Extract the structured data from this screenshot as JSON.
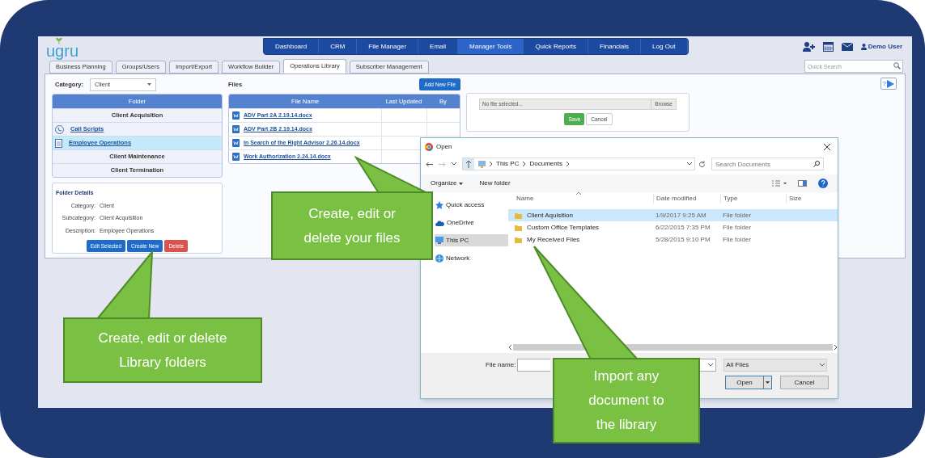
{
  "logo": "ugru",
  "nav": [
    {
      "label": "Dashboard",
      "selected": false
    },
    {
      "label": "CRM",
      "selected": false
    },
    {
      "label": "File Manager",
      "selected": false
    },
    {
      "label": "Email",
      "selected": false
    },
    {
      "label": "Manager Tools",
      "selected": true
    },
    {
      "label": "Quick Reports",
      "selected": false
    },
    {
      "label": "Financials",
      "selected": false
    },
    {
      "label": "Log Out",
      "selected": false
    }
  ],
  "user": "Demo User",
  "search": {
    "placeholder": "Quick Search"
  },
  "tabs": [
    {
      "label": "Business Planning",
      "selected": false
    },
    {
      "label": "Groups/Users",
      "selected": false
    },
    {
      "label": "Import/Export",
      "selected": false
    },
    {
      "label": "Workflow Builder",
      "selected": false
    },
    {
      "label": "Operations Library",
      "selected": true
    },
    {
      "label": "Subscriber Management",
      "selected": false
    }
  ],
  "category": {
    "label": "Category:",
    "value": "Client"
  },
  "folders": {
    "heading": "Folder",
    "rows": [
      {
        "kind": "group",
        "label": "Client Acquisition",
        "selected": false
      },
      {
        "kind": "script",
        "label": "Call Scripts",
        "selected": false
      },
      {
        "kind": "document",
        "label": "Employee Operations",
        "selected": true
      },
      {
        "kind": "group",
        "label": "Client Maintenance",
        "selected": false
      },
      {
        "kind": "group",
        "label": "Client Termination",
        "selected": false
      }
    ]
  },
  "folder_details": {
    "title": "Folder Details",
    "fields": [
      {
        "label": "Category:",
        "value": "Client"
      },
      {
        "label": "Subcategory:",
        "value": "Client Acquisition"
      },
      {
        "label": "Description:",
        "value": "Employee Operations"
      }
    ],
    "buttons": [
      {
        "label": "Edit Selected",
        "kind": "primary"
      },
      {
        "label": "Create New",
        "kind": "primary"
      },
      {
        "label": "Delete",
        "kind": "danger"
      }
    ]
  },
  "files": {
    "title": "Files",
    "add_button": "Add New File",
    "columns": [
      "File Name",
      "Last Updated",
      "By"
    ],
    "rows": [
      {
        "name": "ADV Part 2A 2.19.14.docx"
      },
      {
        "name": "ADV Part 2B 2.19.14.docx"
      },
      {
        "name": "In Search of the Right Advisor 2.26.14.docx"
      },
      {
        "name": "Work Authorization 2.24.14.docx"
      }
    ]
  },
  "upload": {
    "placeholder": "No file selected...",
    "browse": "Browse",
    "save": "Save",
    "cancel": "Cancel"
  },
  "help": "?",
  "dialog": {
    "title": "Open",
    "path": [
      "This PC",
      "Documents"
    ],
    "search_placeholder": "Search Documents",
    "toolbar": [
      "Organize",
      "New folder"
    ],
    "nav": [
      {
        "label": "Quick access",
        "selected": false
      },
      {
        "label": "OneDrive",
        "selected": false
      },
      {
        "label": "This PC",
        "selected": true
      },
      {
        "label": "Network",
        "selected": false
      }
    ],
    "columns": [
      "Name",
      "Date modified",
      "Type",
      "Size"
    ],
    "rows": [
      {
        "name": "Client Aquisition",
        "date": "1/9/2017 9:25 AM",
        "type": "File folder",
        "selected": true
      },
      {
        "name": "Custom Office Templates",
        "date": "6/22/2015 7:35 PM",
        "type": "File folder",
        "selected": false
      },
      {
        "name": "My Received Files",
        "date": "5/28/2015 9:10 PM",
        "type": "File folder",
        "selected": false
      }
    ],
    "file_name_label": "File name:",
    "filter": "All Files",
    "open": "Open",
    "cancel": "Cancel"
  },
  "callouts": [
    {
      "text": "Create, edit or delete your files"
    },
    {
      "text": "Create, edit or delete Library folders"
    },
    {
      "text": "Import any document to the library"
    }
  ]
}
